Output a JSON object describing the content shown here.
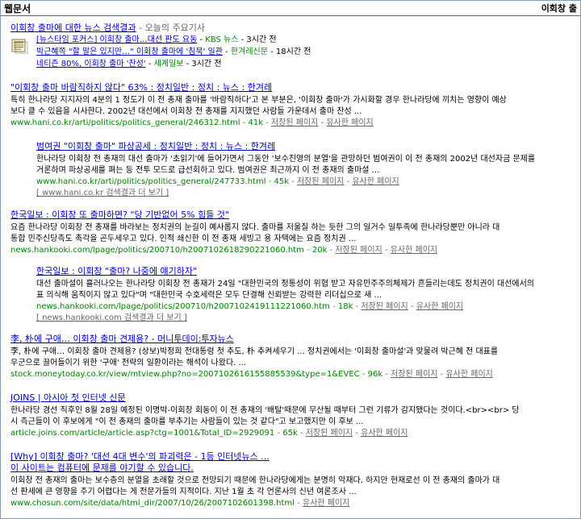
{
  "header": {
    "tab": "웹문서",
    "right_text": "이회창 출"
  },
  "news": {
    "heading_link": "이회창 출마에 대한 뉴스 검색결과",
    "heading_sep": " - ",
    "heading_suffix": "오늘의 주요기사",
    "items": [
      {
        "title": "[뉴스타임 포커스] 이회창 출마…대선 판도 요동",
        "source": "KBS 뉴스",
        "time": "3시간 전"
      },
      {
        "title": "박근혜쪽 \"할 말은 있지만…\" 이회창 출마에 '침묵' 일관",
        "source": "한겨레신문",
        "time": "18시간 전"
      },
      {
        "title": "네티즌 80%, 이회창 출마 '찬성'",
        "source": "세계일보",
        "time": "3시간 전"
      }
    ]
  },
  "results": [
    {
      "title": "\"이회창 출마 바람직하지 않다\" 63% : 정치일반 : 정치 : 뉴스 : 한겨레",
      "snippet": [
        "특히 한나라당 지지자의 4분의 1 정도가 이 전 총재 출마를 '바람직하다'고 본 부분은, '이회창 출마'가 가시화할 경우 한나라당에 끼치는 영향이 예상",
        "보다 클 수 있음을 시사한다. 2002년 대선에서 이회창 전 총재를 지지했던 사람들 가운데서 출마 찬성 ..."
      ],
      "url": "www.hani.co.kr/arti/politics/politics_general/246312.html",
      "size": "41k",
      "cache": "저장된 페이지",
      "similar": "유사한 페이지",
      "more": ""
    },
    {
      "title": "범여권 \"이회창 출마\" 파상공세 : 정치일반 : 정치 : 뉴스 : 한겨레",
      "snippet": [
        "한나라당 이회창 전 총재의 대선 출마가 '초읽기'에 들어가면서 그동안 '보수진영의 분열'을 관망하던 범여권이 이 전 총재의 2002년 대선자금 문제를",
        "거론하며 파상공세를 펴는 등 전투 모드로 급선회하고 있다. 범여권은 최근까지 이 전 총재의 출마설 ..."
      ],
      "url": "www.hani.co.kr/arti/politics/politics_general/247733.html",
      "size": "45k",
      "cache": "저장된 페이지",
      "similar": "유사한 페이지",
      "more": "[ www.hani.co.kr 검색결과 더 보기 ]"
    },
    {
      "title": "한국일보 : 이회창 또 출마하면? \"당 기반없어 5% 힘들 것\"",
      "snippet": [
        "요즘 한나라당 이회창 전 총재를 바라보는 정치권의 눈길이 예사롭지 않다. 출마를 저울질 하는 듯한 그의 일거수 일투족에 한나라당뿐만 아니라 대",
        "통합 민주신당측도 촉각을 곤두세우고 있다. 인적 쇄신한 이 전 총재 세빙고 용 자택에는 요즘 정치권 ..."
      ],
      "url": "news.hankooki.com/lpage/politics/200710/h2007102618290221060.htm",
      "size": "20k",
      "cache": "저장된 페이지",
      "similar": "유사한 페이지",
      "more": ""
    },
    {
      "title": "한국일보 : 이회창 \"출마? 나중에 얘기하자\"",
      "snippet": [
        "대선 출마설이 흘러나오는 한나라당 이회창 전 총재가 24일 \"대한민국의 정통성이 위협 받고 자유민주주의체제가 흔들리는데도 정치권이 대선에서의",
        "표 의식해 움직이지 않고 있다\"며 \"대한민국 수호세력은 모두 단결해 신뢰받는 강력한 리더십으로 새 ..."
      ],
      "url": "news.hankooki.com/lpage/politics/200710/h2007102419111221060.htm",
      "size": "18k",
      "cache": "저장된 페이지",
      "similar": "유사한 페이지",
      "more": "[ news.hankooki.com 검색결과 더 보기 ]"
    },
    {
      "title": "李, 朴에 구애… 이회창 출마 견제용? - 머니투데이:투자뉴스",
      "snippet": [
        "李, 朴에 구애… 이회창 출마 견제용? (상보)박정희 전대통령 첫 추도, 朴 추켜세우기 ... 정치권에서는 '이회창 출마설'과 맞물려 박근혜 전 대표를",
        "우군으로 끌어들이기 위한 '구애' 전략의 일환이라는 해석이 나왔다. ..."
      ],
      "url": "stock.moneytoday.co.kr/view/mtview.php?no=2007102616155885539&type=1&EVEC",
      "size": "96k",
      "cache": "저장된 페이지",
      "similar": "유사한 페이지",
      "more": ""
    },
    {
      "title": "JOINS | 아시아 첫 인터넷 신문",
      "snippet": [
        "한나라당 경선 직후인 8월 28일 예정된 이명박-이회창 회동이 이 전 총재의 '배탈'때문에 무산될 때부터 그런 기류가 감지됐다는 것이다.<br><br> 당",
        "시 측근들이 이 후보에게 \"이 전 총재의 출마를 부추기는 사람들이 있는 것 같다\"고 보고했지만 이 후보 ..."
      ],
      "url": "article.joins.com/article/article.asp?ctg=1001&Total_ID=2929091",
      "size": "65k",
      "cache": "저장된 페이지",
      "similar": "유사한 페이지",
      "more": ""
    },
    {
      "title": "[Why] 이회창 출마? '대선 4대 변수'의 파괴력은 - 1등 인터넷뉴스 ...",
      "warning": "이 사이트는 컴퓨터에 문제를 야기할 수 있습니다.",
      "snippet": [
        "이회창 전 총재의 출마는 보수층의 분열을 초래할 것으로 전망되기 때문에 한나라당에게는 분명히 악재다. 하지만 현재로선 이 전 총재의 출마가 대",
        "선 판세에 큰 영향을 주기 어렵다는 게 전문가들의 지적이다. 지난 1월 초 각 언론사의 신년 여론조사 ..."
      ],
      "url": "www.chosun.com/site/data/html_dir/2007/10/26/2007102601398.html",
      "size": "",
      "cache": "",
      "similar": "유사한 페이지",
      "more": ""
    }
  ]
}
